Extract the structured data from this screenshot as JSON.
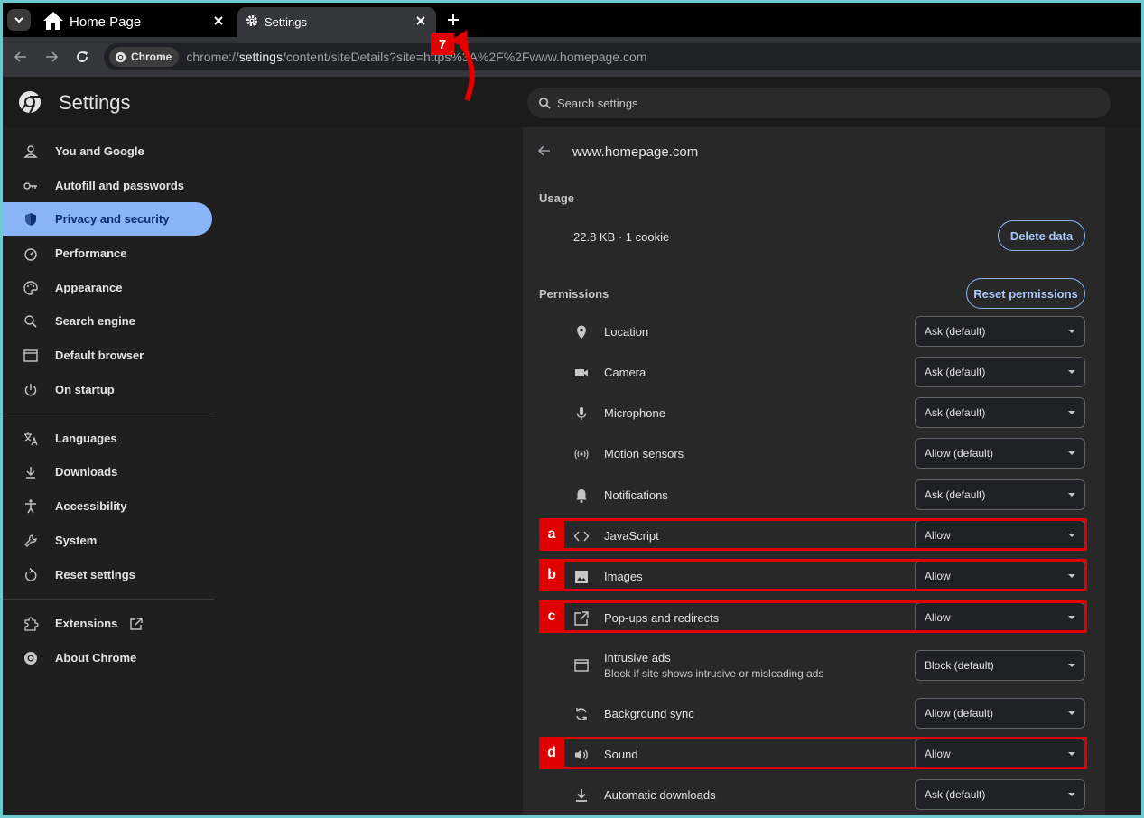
{
  "tabs": [
    {
      "title": "Home Page",
      "icon": "home-icon"
    },
    {
      "title": "Settings",
      "icon": "gear-icon"
    }
  ],
  "toolbar": {
    "chip": "Chrome",
    "url_prefix": "chrome://",
    "url_bold": "settings",
    "url_rest": "/content/siteDetails?site=https%3A%2F%2Fwww.homepage.com"
  },
  "header": {
    "title": "Settings",
    "search_placeholder": "Search settings"
  },
  "sidebar": {
    "items": [
      {
        "label": "You and Google",
        "icon": "person-icon"
      },
      {
        "label": "Autofill and passwords",
        "icon": "key-icon"
      },
      {
        "label": "Privacy and security",
        "icon": "shield-icon",
        "active": true
      },
      {
        "label": "Performance",
        "icon": "gauge-icon"
      },
      {
        "label": "Appearance",
        "icon": "palette-icon"
      },
      {
        "label": "Search engine",
        "icon": "search-icon"
      },
      {
        "label": "Default browser",
        "icon": "browser-window-icon"
      },
      {
        "label": "On startup",
        "icon": "power-icon"
      },
      {
        "label": "Languages",
        "icon": "translate-icon"
      },
      {
        "label": "Downloads",
        "icon": "download-icon"
      },
      {
        "label": "Accessibility",
        "icon": "accessibility-icon"
      },
      {
        "label": "System",
        "icon": "wrench-icon"
      },
      {
        "label": "Reset settings",
        "icon": "reset-icon"
      },
      {
        "label": "Extensions",
        "icon": "puzzle-icon"
      },
      {
        "label": "About Chrome",
        "icon": "chrome-icon"
      }
    ]
  },
  "site": {
    "title": "www.homepage.com",
    "usage_heading": "Usage",
    "usage_value": "22.8 KB · 1 cookie",
    "delete_data": "Delete data",
    "permissions_heading": "Permissions",
    "reset_permissions": "Reset permissions"
  },
  "permissions": [
    {
      "label": "Location",
      "value": "Ask (default)",
      "icon": "location-pin-icon"
    },
    {
      "label": "Camera",
      "value": "Ask (default)",
      "icon": "camera-icon"
    },
    {
      "label": "Microphone",
      "value": "Ask (default)",
      "icon": "microphone-icon"
    },
    {
      "label": "Motion sensors",
      "value": "Allow (default)",
      "icon": "motion-sensor-icon"
    },
    {
      "label": "Notifications",
      "value": "Ask (default)",
      "icon": "bell-icon"
    },
    {
      "label": "JavaScript",
      "value": "Allow",
      "icon": "code-icon",
      "highlight": "a"
    },
    {
      "label": "Images",
      "value": "Allow",
      "icon": "image-icon",
      "highlight": "b"
    },
    {
      "label": "Pop-ups and redirects",
      "value": "Allow",
      "icon": "popup-icon",
      "highlight": "c"
    },
    {
      "label": "Intrusive ads",
      "sublabel": "Block if site shows intrusive or misleading ads",
      "value": "Block (default)",
      "icon": "ads-window-icon"
    },
    {
      "label": "Background sync",
      "value": "Allow (default)",
      "icon": "sync-icon"
    },
    {
      "label": "Sound",
      "value": "Allow",
      "icon": "speaker-icon",
      "highlight": "d"
    },
    {
      "label": "Automatic downloads",
      "value": "Ask (default)",
      "icon": "download-icon"
    }
  ],
  "annotations": {
    "step": "7",
    "accent": "#e00000"
  }
}
